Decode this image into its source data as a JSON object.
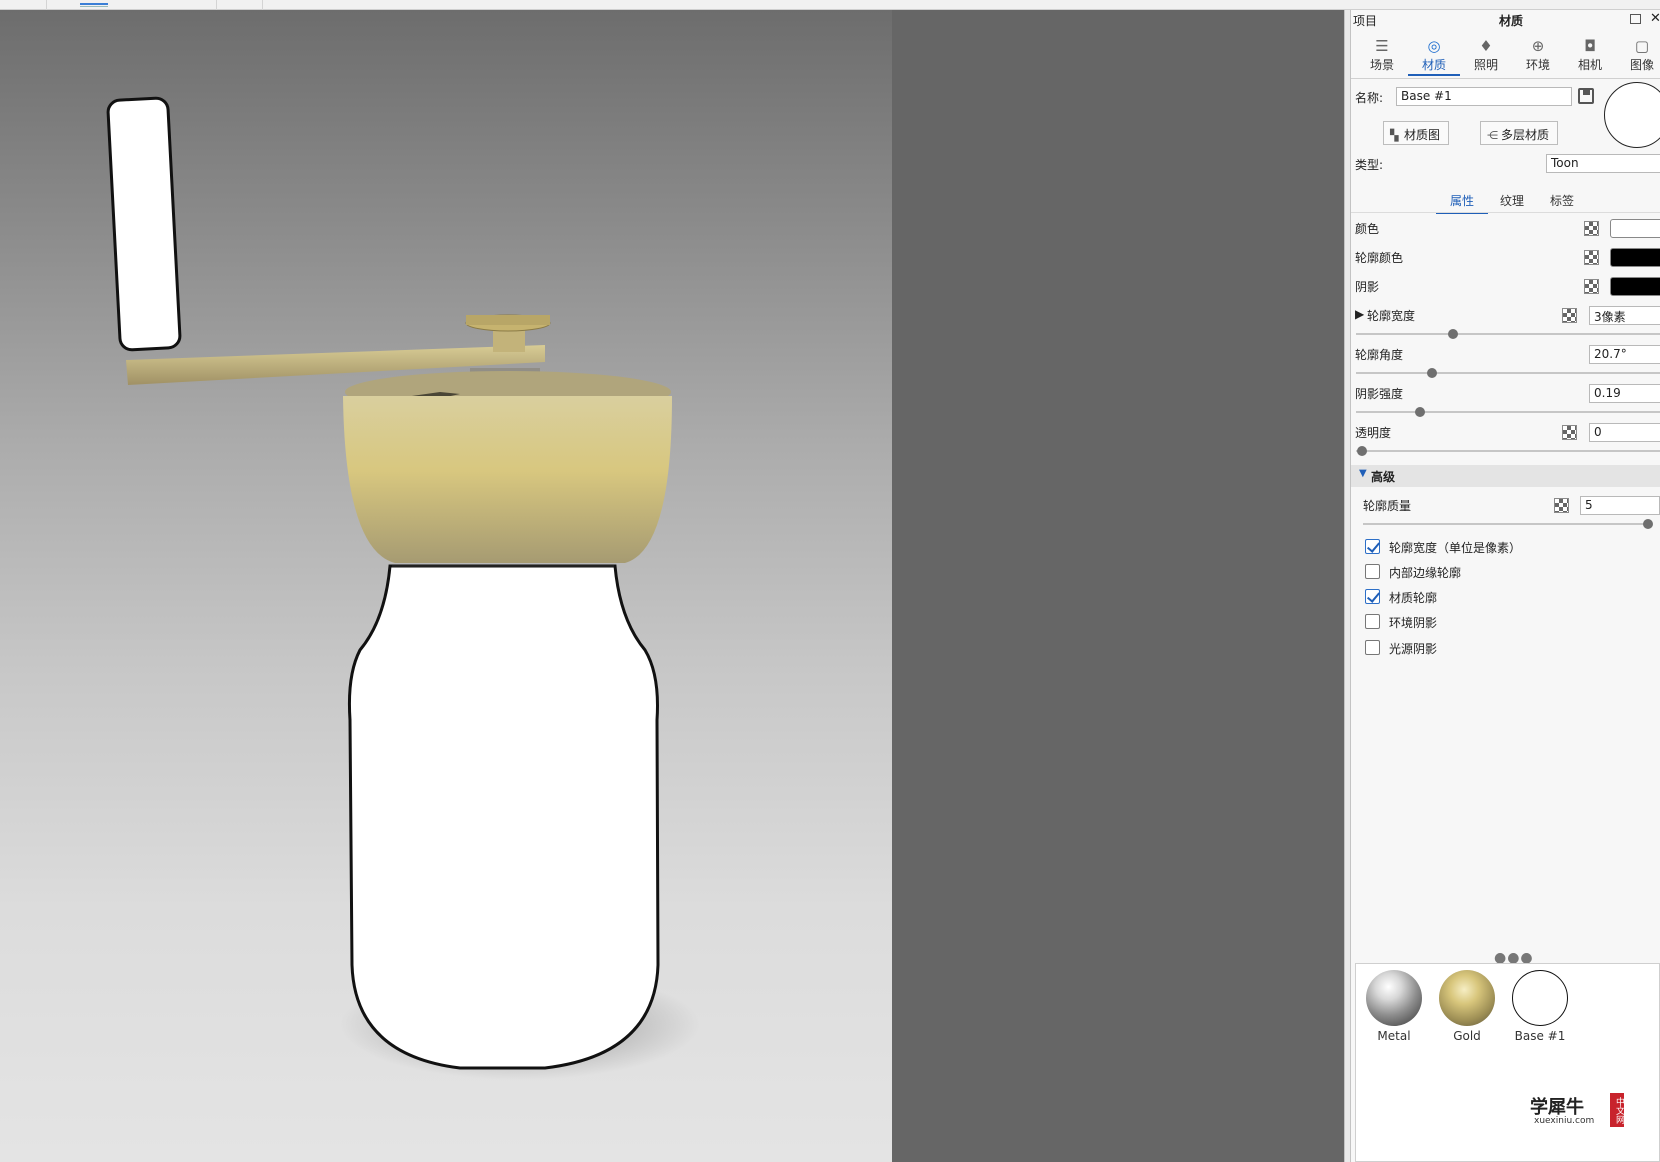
{
  "panel": {
    "project_label": "项目",
    "title": "材质",
    "tabs": [
      {
        "label": "场景",
        "icon": "scene-icon"
      },
      {
        "label": "材质",
        "icon": "material-icon"
      },
      {
        "label": "照明",
        "icon": "lighting-icon"
      },
      {
        "label": "环境",
        "icon": "environment-icon"
      },
      {
        "label": "相机",
        "icon": "camera-icon"
      },
      {
        "label": "图像",
        "icon": "image-icon"
      }
    ],
    "name_label": "名称:",
    "name_value": "Base #1",
    "material_graph_label": "材质图",
    "multi_layer_label": "多层材质",
    "type_label": "类型:",
    "type_value": "Toon",
    "subtabs": [
      "属性",
      "纹理",
      "标签"
    ],
    "properties": {
      "color_label": "颜色",
      "outline_color_label": "轮廓颜色",
      "shadow_label": "阴影",
      "outline_width_label": "轮廓宽度",
      "outline_width_value": "3像素",
      "outline_angle_label": "轮廓角度",
      "outline_angle_value": "20.7°",
      "shadow_strength_label": "阴影强度",
      "shadow_strength_value": "0.19",
      "transparency_label": "透明度",
      "transparency_value": "0"
    },
    "advanced": {
      "header": "高级",
      "outline_quality_label": "轮廓质量",
      "outline_quality_value": "5",
      "checkboxes": [
        {
          "label": "轮廓宽度（单位是像素）",
          "checked": true
        },
        {
          "label": "内部边缘轮廓",
          "checked": false
        },
        {
          "label": "材质轮廓",
          "checked": true
        },
        {
          "label": "环境阴影",
          "checked": false
        },
        {
          "label": "光源阴影",
          "checked": false
        }
      ]
    },
    "colors": {
      "color": "#ffffff",
      "outline_color": "#000000",
      "shadow": "#000000",
      "accent": "#1f5fb8"
    }
  },
  "library": {
    "materials": [
      {
        "label": "Metal"
      },
      {
        "label": "Gold"
      },
      {
        "label": "Base #1"
      }
    ]
  },
  "watermark": {
    "main": "学犀牛",
    "sub": "xuexiniu.com",
    "tag": "中文网"
  }
}
